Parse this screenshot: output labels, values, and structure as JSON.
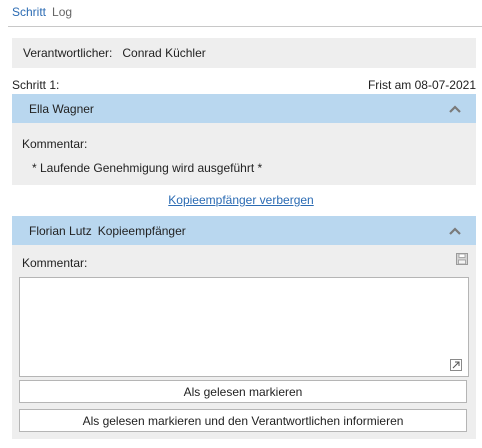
{
  "tabs": [
    {
      "label": "Schritt",
      "active": true
    },
    {
      "label": "Log",
      "active": false
    }
  ],
  "responsible": {
    "label": "Verantwortlicher:",
    "value": "Conrad Küchler"
  },
  "step": {
    "label": "Schritt 1:",
    "due": "Frist am 08-07-2021"
  },
  "approver": {
    "name": "Ella Wagner",
    "comment_label": "Kommentar:",
    "comment_text": "* Laufende Genehmigung wird ausgeführt *"
  },
  "copy_link": "Kopieempfänger verbergen",
  "cc": {
    "name": "Florian Lutz",
    "role": "Kopieempfänger",
    "comment_label": "Kommentar:",
    "comment_value": "",
    "buttons": {
      "mark_read": "Als gelesen markieren",
      "mark_read_inform": "Als gelesen markieren und den Verantwortlichen informieren"
    }
  },
  "colors": {
    "accent": "#2b6bb3",
    "header_bar": "#b9d7ef",
    "panel_bg": "#eeeeee"
  },
  "icons": [
    "chevron-up-icon",
    "save-icon",
    "resize-icon"
  ]
}
